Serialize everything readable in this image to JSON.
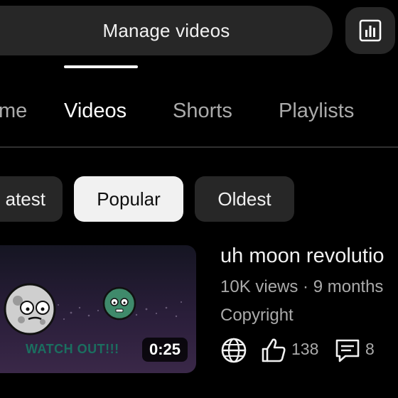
{
  "header": {
    "manage_label": "Manage videos",
    "analytics_icon": "bar-chart-icon"
  },
  "tabs": [
    {
      "label": "Home",
      "visible_text": "me",
      "active": false
    },
    {
      "label": "Videos",
      "active": true
    },
    {
      "label": "Shorts",
      "active": false
    },
    {
      "label": "Playlists",
      "active": false
    }
  ],
  "filters": [
    {
      "label": "Latest",
      "visible_text": "atest",
      "selected": false
    },
    {
      "label": "Popular",
      "selected": true
    },
    {
      "label": "Oldest",
      "selected": false
    }
  ],
  "video": {
    "title": "uh moon revolutio",
    "meta": "10K views · 9 months",
    "status": "Copyright",
    "duration": "0:25",
    "thumbnail_text": "WATCH OUT!!!",
    "likes": "138",
    "comments": "8",
    "visibility_icon": "globe-icon",
    "likes_icon": "thumbs-up-icon",
    "comments_icon": "comment-icon"
  },
  "colors": {
    "background": "#000000",
    "surface": "#272727",
    "text_primary": "#f1f1f1",
    "text_secondary": "#aaaaaa",
    "chip_selected": "#f1f1f1"
  }
}
